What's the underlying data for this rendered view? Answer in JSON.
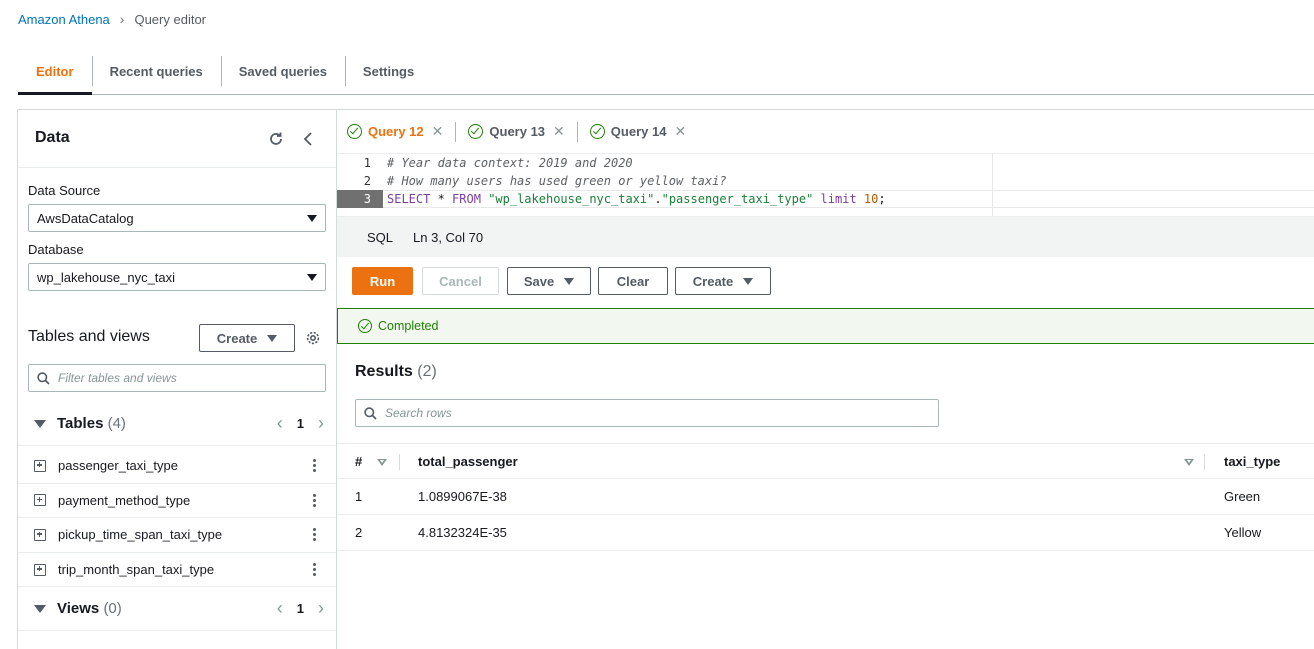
{
  "breadcrumb": {
    "root": "Amazon Athena",
    "current": "Query editor"
  },
  "top_tabs": [
    "Editor",
    "Recent queries",
    "Saved queries",
    "Settings"
  ],
  "data_panel": {
    "title": "Data",
    "data_source_label": "Data Source",
    "data_source_value": "AwsDataCatalog",
    "database_label": "Database",
    "database_value": "wp_lakehouse_nyc_taxi",
    "tables_views_title": "Tables and views",
    "create_label": "Create",
    "filter_placeholder": "Filter tables and views",
    "tables_label": "Tables",
    "tables_count": "(4)",
    "tables_page": "1",
    "tables": [
      "passenger_taxi_type",
      "payment_method_type",
      "pickup_time_span_taxi_type",
      "trip_month_span_taxi_type"
    ],
    "views_label": "Views",
    "views_count": "(0)",
    "views_page": "1"
  },
  "query_tabs": [
    "Query 12",
    "Query 13",
    "Query 14"
  ],
  "editor": {
    "line_numbers": [
      "1",
      "2",
      "3"
    ],
    "line1": "# Year data context: 2019 and 2020",
    "line2": "# How many users has used green or yellow taxi?",
    "line3": {
      "select": "SELECT",
      "star": " * ",
      "from": "FROM",
      "sp1": " ",
      "db": "\"wp_lakehouse_nyc_taxi\"",
      "dot": ".",
      "table": "\"passenger_taxi_type\"",
      "sp2": " ",
      "limit": "limit",
      "sp3": " ",
      "num": "10",
      "semi": ";"
    }
  },
  "status_bar": {
    "language": "SQL",
    "position": "Ln 3, Col 70"
  },
  "actions": {
    "run": "Run",
    "cancel": "Cancel",
    "save": "Save",
    "clear": "Clear",
    "create": "Create"
  },
  "status_message": "Completed",
  "results": {
    "title": "Results",
    "count": "(2)",
    "search_placeholder": "Search rows",
    "columns": [
      "#",
      "total_passenger",
      "taxi_type"
    ],
    "rows": [
      {
        "index": "1",
        "total_passenger": "1.0899067E-38",
        "taxi_type": "Green"
      },
      {
        "index": "2",
        "total_passenger": "4.8132324E-35",
        "taxi_type": "Yellow"
      }
    ]
  },
  "colors": {
    "accent": "#ec7211",
    "link": "#0073bb",
    "success": "#1d8102"
  }
}
